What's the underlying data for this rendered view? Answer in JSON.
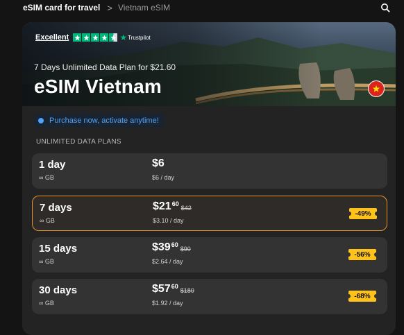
{
  "breadcrumb": {
    "home": "eSIM card for travel",
    "separator": ">",
    "current": "Vietnam eSIM"
  },
  "icons": {
    "search": "search-icon",
    "info": "info-icon",
    "flag": "vietnam-flag-icon"
  },
  "trustpilot": {
    "label": "Excellent",
    "brand": "Trustpilot",
    "rating_stars": 4.5,
    "color": "#00b67a"
  },
  "hero": {
    "subtitle": "7 Days Unlimited Data Plan for $21.60",
    "title": "eSIM Vietnam"
  },
  "notice": "Purchase now, activate anytime!",
  "plans_heading": "UNLIMITED DATA PLANS",
  "plans": [
    {
      "name": "1 day",
      "data": "∞ GB",
      "price_main": "$6",
      "price_cents": "",
      "price_old": "",
      "per_day": "$6 / day",
      "discount": "",
      "selected": false
    },
    {
      "name": "7 days",
      "data": "∞ GB",
      "price_main": "$21",
      "price_cents": "60",
      "price_old": "$42",
      "per_day": "$3.10 / day",
      "discount": "-49%",
      "selected": true
    },
    {
      "name": "15 days",
      "data": "∞ GB",
      "price_main": "$39",
      "price_cents": "60",
      "price_old": "$90",
      "per_day": "$2.64 / day",
      "discount": "-56%",
      "selected": false
    },
    {
      "name": "30 days",
      "data": "∞ GB",
      "price_main": "$57",
      "price_cents": "60",
      "price_old": "$180",
      "per_day": "$1.92 / day",
      "discount": "-68%",
      "selected": false
    }
  ],
  "colors": {
    "accent": "#e8922a",
    "badge": "#ffc21a",
    "notice": "#4da3ff"
  }
}
